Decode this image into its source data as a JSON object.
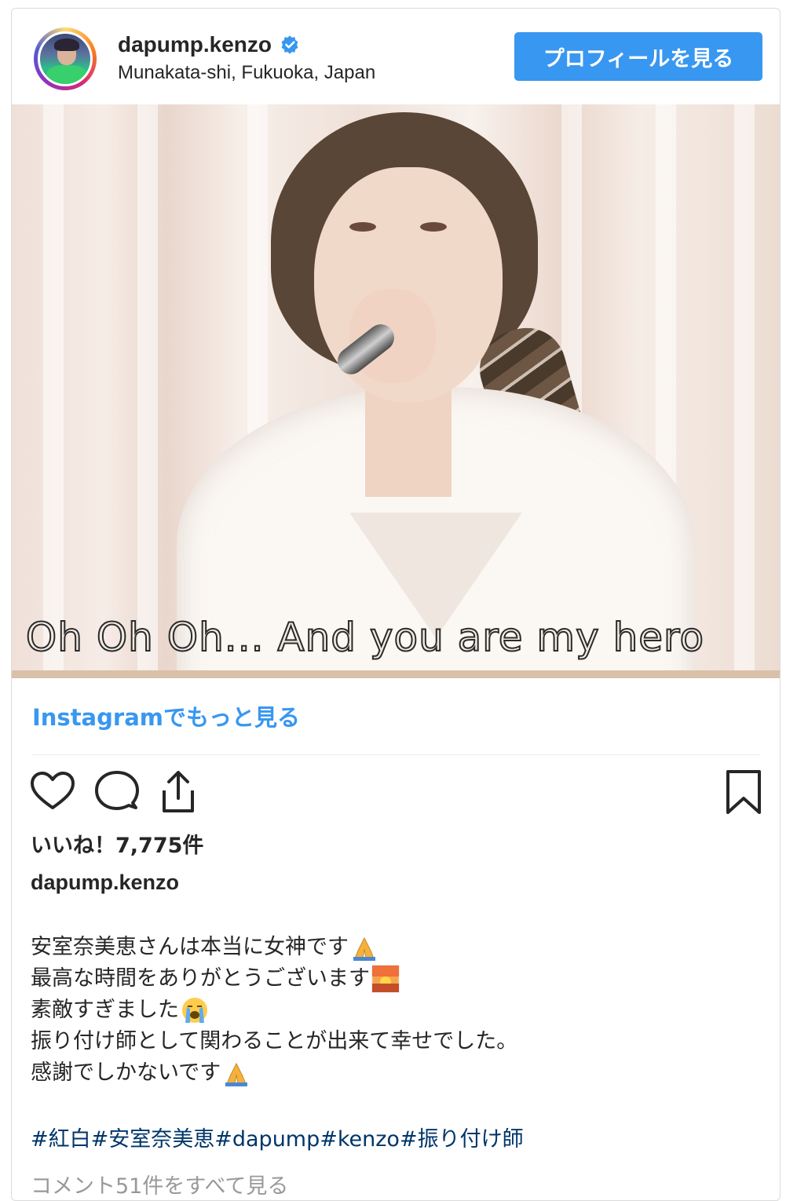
{
  "header": {
    "username": "dapump.kenzo",
    "location": "Munakata-shi, Fukuoka, Japan",
    "profile_button": "プロフィールを見る",
    "verified_icon": "verified-badge-icon"
  },
  "photo": {
    "subtitle": "Oh Oh Oh... And you are my hero"
  },
  "more_link": "Instagramでもっと見る",
  "actions": {
    "like_icon": "heart-icon",
    "comment_icon": "comment-bubble-icon",
    "share_icon": "share-icon",
    "save_icon": "bookmark-icon"
  },
  "likes": "いいね！7,775件",
  "caption": {
    "username": "dapump.kenzo",
    "lines": [
      {
        "text": "安室奈美恵さんは本当に女神です",
        "emoji": "folded-hands-emoji"
      },
      {
        "text": "最高な時間をありがとうございます",
        "emoji": "sunrise-emoji"
      },
      {
        "text": "素敵すぎました",
        "emoji": "crying-face-emoji"
      },
      {
        "text": "振り付け師として関わることが出来て幸せでした。",
        "emoji": ""
      },
      {
        "text": "感謝でしかないです",
        "emoji": "folded-hands-emoji"
      }
    ],
    "hashtags": "#紅白#安室奈美恵#dapump#kenzo#振り付け師"
  },
  "comments_link": "コメント51件をすべて見る",
  "colors": {
    "accent": "#3897f0",
    "hashtag": "#003569",
    "border": "#dbdbdb"
  }
}
